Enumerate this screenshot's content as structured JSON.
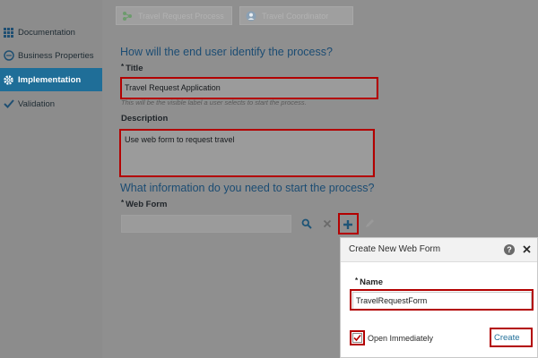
{
  "sidebar": {
    "items": [
      {
        "label": "Documentation",
        "icon": "grid-icon"
      },
      {
        "label": "Business Properties",
        "icon": "chat-icon"
      },
      {
        "label": "Implementation",
        "icon": "gear-icon",
        "active": true
      },
      {
        "label": "Validation",
        "icon": "check-icon"
      }
    ]
  },
  "toolbar": {
    "button1_label": "Travel Request Process",
    "button2_label": "Travel Coordinator"
  },
  "identify_section": {
    "heading": "How will the end user identify the process?",
    "title_label": "Title",
    "title_value": "Travel Request Application",
    "title_hint": "This will be the visible label a user selects to start the process.",
    "description_label": "Description",
    "description_value": "Use web form to request travel"
  },
  "start_section": {
    "heading": "What information do you need to start the process?",
    "webform_label": "Web Form",
    "webform_value": ""
  },
  "dialog": {
    "title": "Create New Web Form",
    "name_label": "Name",
    "name_value": "TravelRequestForm",
    "open_immediately_label": "Open Immediately",
    "open_immediately_checked": true,
    "create_label": "Create"
  },
  "colors": {
    "accent": "#1f6e98",
    "highlight": "#b30000",
    "heading": "#1b4c73"
  }
}
